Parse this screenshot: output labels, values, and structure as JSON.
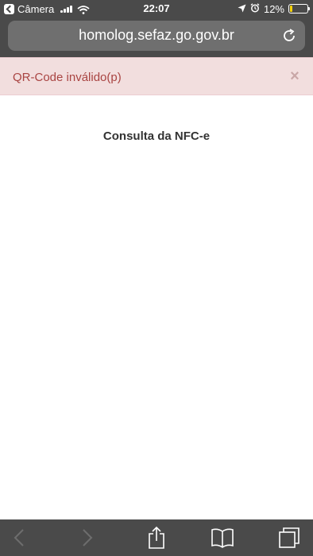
{
  "status_bar": {
    "app_name": "Câmera",
    "time": "22:07",
    "battery_percent": "12%",
    "battery_level": 0.12,
    "battery_color": "#f5d20a",
    "icons": [
      "back-to-app-icon",
      "signal-icon",
      "wifi-icon",
      "location-icon",
      "alarm-icon",
      "battery-icon"
    ]
  },
  "address_bar": {
    "url": "homolog.sefaz.go.gov.br",
    "reload_icon": "reload-icon"
  },
  "alert": {
    "message": "QR-Code inválido(p)",
    "close_glyph": "×",
    "background": "#f2dede",
    "text_color": "#a94442"
  },
  "page": {
    "title": "Consulta da NFC-e"
  },
  "toolbar": {
    "icons": [
      "back-icon",
      "forward-icon",
      "share-icon",
      "bookmarks-icon",
      "tabs-icon"
    ]
  }
}
